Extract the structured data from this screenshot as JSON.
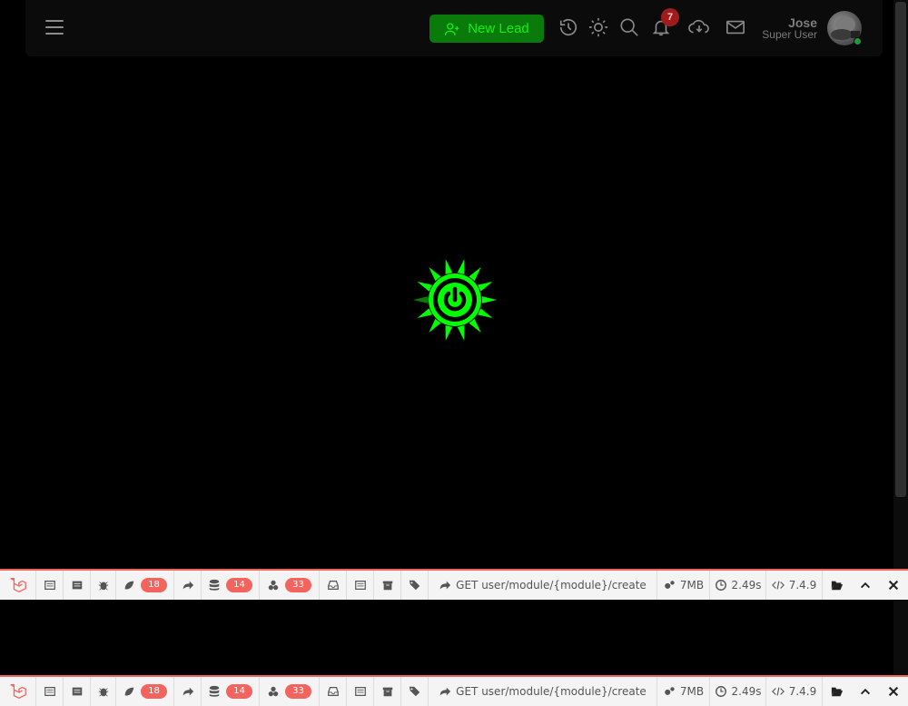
{
  "header": {
    "new_lead_label": "New Lead",
    "notification_count": "7",
    "user": {
      "name": "Jose",
      "role": "Super User",
      "status_color": "#1b9a3a"
    }
  },
  "loader": {
    "color": "#00ff00"
  },
  "debugbar": {
    "badges": {
      "messages": "18",
      "queries": "14",
      "models": "33"
    },
    "route": "GET user/module/{module}/create",
    "memory": "7MB",
    "time": "2.49s",
    "php_version": "7.4.9"
  },
  "colors": {
    "accent": "#0a7a0a",
    "accent_text": "#0ff00f",
    "debugbar_accent": "#f4645f"
  }
}
